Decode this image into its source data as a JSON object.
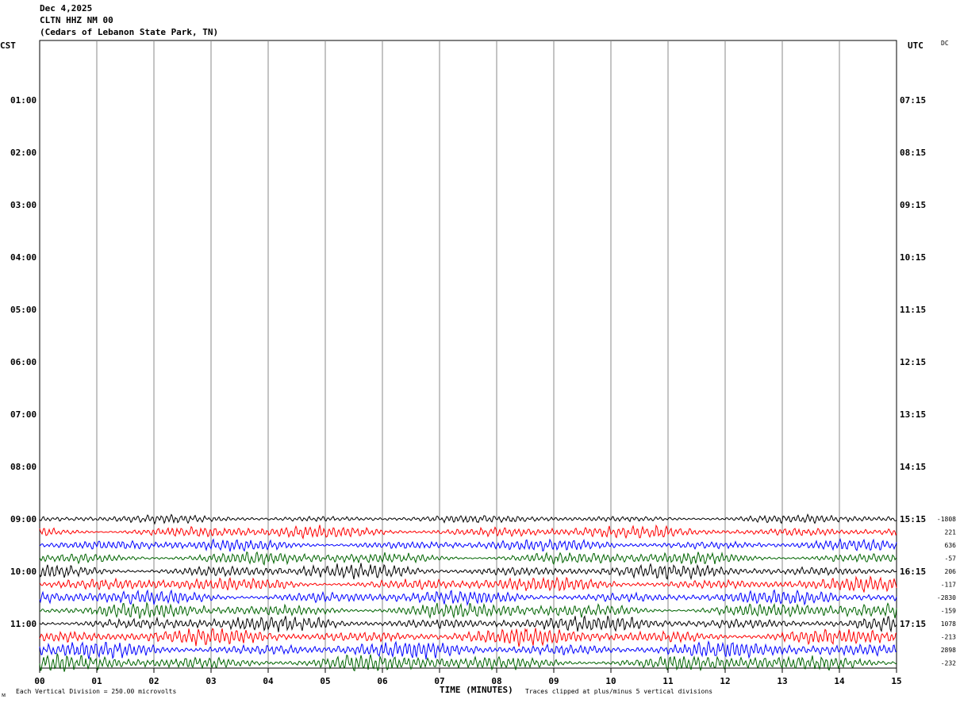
{
  "header": {
    "date": "Dec 4,2025",
    "station": "CLTN HHZ NM 00",
    "location": "(Cedars of Lebanon State Park, TN)"
  },
  "left_tz": "CST",
  "right_tz": "UTC",
  "corner_tag": "DC",
  "footer": {
    "scale": "Each Vertical Division =  250.00 microvolts",
    "xlabel": "TIME (MINUTES)",
    "clip_note": "Traces clipped at plus/minus 5 vertical divisions"
  },
  "chart_data": {
    "type": "line",
    "title": "CLTN HHZ NM 00",
    "xlabel": "TIME (MINUTES)",
    "xlim": [
      0,
      15
    ],
    "x_ticks": [
      "00",
      "01",
      "02",
      "03",
      "04",
      "05",
      "06",
      "07",
      "08",
      "09",
      "10",
      "11",
      "12",
      "13",
      "14",
      "15"
    ],
    "left_hour_labels": [
      "01:00",
      "02:00",
      "03:00",
      "04:00",
      "05:00",
      "06:00",
      "07:00",
      "08:00",
      "09:00",
      "10:00",
      "11:00"
    ],
    "right_hour_labels": [
      "07:15",
      "08:15",
      "09:15",
      "10:15",
      "11:15",
      "12:15",
      "13:15",
      "14:15",
      "15:15",
      "16:15",
      "17:15"
    ],
    "grid": true,
    "trace_colors": [
      "#000000",
      "#ff0000",
      "#0000ff",
      "#006400"
    ],
    "first_trace_row": 36,
    "traces": [
      {
        "offset": "-1808",
        "amplitude": 0.35
      },
      {
        "offset": "221",
        "amplitude": 0.55
      },
      {
        "offset": "636",
        "amplitude": 0.5
      },
      {
        "offset": "-57",
        "amplitude": 0.55
      },
      {
        "offset": "206",
        "amplitude": 0.6
      },
      {
        "offset": "-117",
        "amplitude": 0.6
      },
      {
        "offset": "-2830",
        "amplitude": 0.6
      },
      {
        "offset": "-159",
        "amplitude": 0.65
      },
      {
        "offset": "1078",
        "amplitude": 0.65
      },
      {
        "offset": "-213",
        "amplitude": 0.7
      },
      {
        "offset": "2898",
        "amplitude": 0.7
      },
      {
        "offset": "-232",
        "amplitude": 0.7
      }
    ],
    "last_trace_end_minute": 15
  }
}
